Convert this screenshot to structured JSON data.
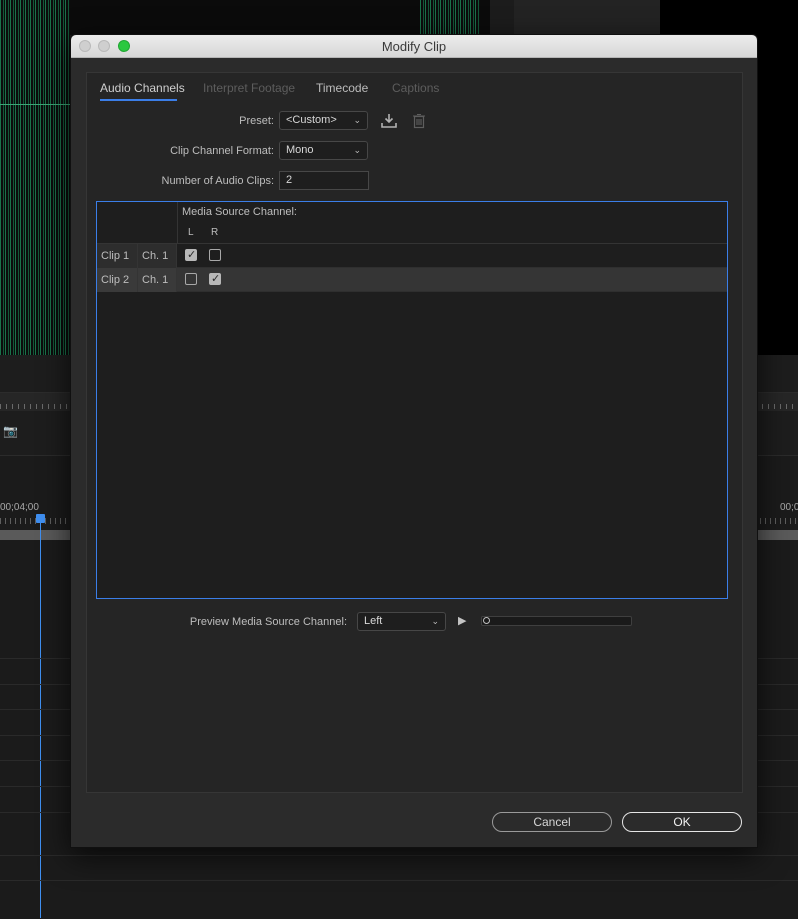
{
  "window": {
    "title": "Modify Clip"
  },
  "tabs": [
    {
      "label": "Audio Channels",
      "active": true
    },
    {
      "label": "Interpret Footage",
      "active": false
    },
    {
      "label": "Timecode",
      "active": false
    },
    {
      "label": "Captions",
      "active": false
    }
  ],
  "form": {
    "preset_label": "Preset:",
    "preset_value": "<Custom>",
    "format_label": "Clip Channel Format:",
    "format_value": "Mono",
    "num_clips_label": "Number of Audio Clips:",
    "num_clips_value": "2"
  },
  "grid": {
    "header": "Media Source Channel:",
    "columns": [
      "L",
      "R"
    ],
    "rows": [
      {
        "clip": "Clip 1",
        "channel": "Ch. 1",
        "L": true,
        "R": false,
        "selected": false
      },
      {
        "clip": "Clip 2",
        "channel": "Ch. 1",
        "L": false,
        "R": true,
        "selected": true
      }
    ]
  },
  "preview": {
    "label": "Preview Media Source Channel:",
    "value": "Left"
  },
  "buttons": {
    "cancel": "Cancel",
    "ok": "OK"
  },
  "background": {
    "timecode_left": "00;04;00",
    "timecode_right": "00;0"
  },
  "colors": {
    "accent": "#3b7ee8",
    "waveform": "#1f8a5a",
    "zoom_button": "#2bc840"
  },
  "icons": {
    "save_preset": "download-tray-icon",
    "delete_preset": "trash-icon",
    "play": "play-icon",
    "camera": "camera-icon"
  }
}
